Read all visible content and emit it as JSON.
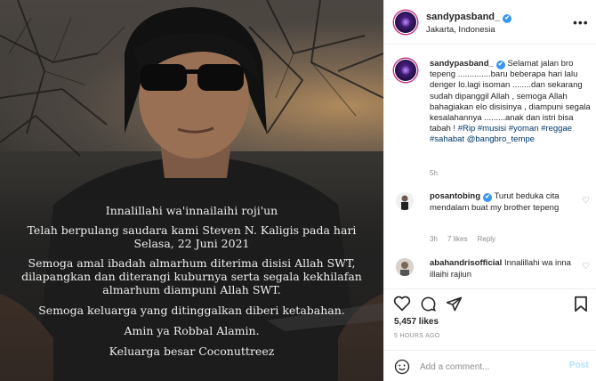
{
  "photo": {
    "message_lines": [
      "Innalillahi wa'innailaihi roji'un",
      "",
      "Telah berpulang saudara kami Steven N. Kaligis pada hari",
      "Selasa, 22 Juni 2021",
      "",
      "Semoga amal ibadah almarhum diterima disisi Allah SWT,",
      "dilapangkan dan diterangi kuburnya serta segala kekhilafan",
      "almarhum diampuni Allah SWT.",
      "",
      "Semoga keluarga yang ditinggalkan diberi ketabahan.",
      "",
      "Amin ya Robbal Alamin.",
      "",
      "Keluarga besar Coconuttreez"
    ]
  },
  "header": {
    "username": "sandypasband_",
    "verified_mark": "✔",
    "location": "Jakarta, Indonesia",
    "more": "•••"
  },
  "caption": {
    "username": "sandypasband_",
    "text": "Selamat jalan bro tepeng ..............baru beberapa hari lalu denger lo.lagi isoman ........dan sekarang sudah dipanggil Allah , semoga Allah bahagiakan elo disisinya , diampuni segala kesalahannya .........anak dan istri bisa tabah ! ",
    "hashtags": "#Rip #musisi #yoman #reggae #sahabat @bangbro_tempe",
    "time": "5h"
  },
  "comments": [
    {
      "username": "posantobing",
      "text": "Turut beduka cita mendalam buat my brother tepeng",
      "time": "3h",
      "likes": "7 likes",
      "reply": "Reply"
    },
    {
      "username": "abahandrisofficial",
      "text": "Innalillahi wa inna illaihi rajiun"
    }
  ],
  "actions": {
    "likes": "5,457 likes",
    "ago": "5 HOURS AGO",
    "comment_placeholder": "Add a comment...",
    "post_label": "Post"
  }
}
